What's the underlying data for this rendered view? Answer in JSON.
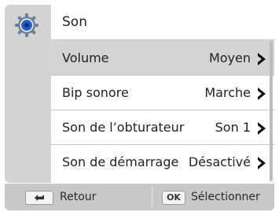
{
  "header": {
    "title": "Son",
    "icon": "gear-icon"
  },
  "menu": {
    "items": [
      {
        "label": "Volume",
        "value": "Moyen",
        "selected": true
      },
      {
        "label": "Bip sonore",
        "value": "Marche",
        "selected": false
      },
      {
        "label": "Son de l’obturateur",
        "value": "Son 1",
        "selected": false
      },
      {
        "label": "Son de démarrage",
        "value": "Désactivé",
        "selected": false
      }
    ]
  },
  "footer": {
    "back_key_icon": "return-arrow-icon",
    "back_label": "Retour",
    "ok_key_text": "OK",
    "ok_label": "Sélectionner"
  },
  "colors": {
    "accent_blue": "#1f5fd0",
    "selected_row": "#d4d4d4",
    "chevron": "#111111"
  }
}
